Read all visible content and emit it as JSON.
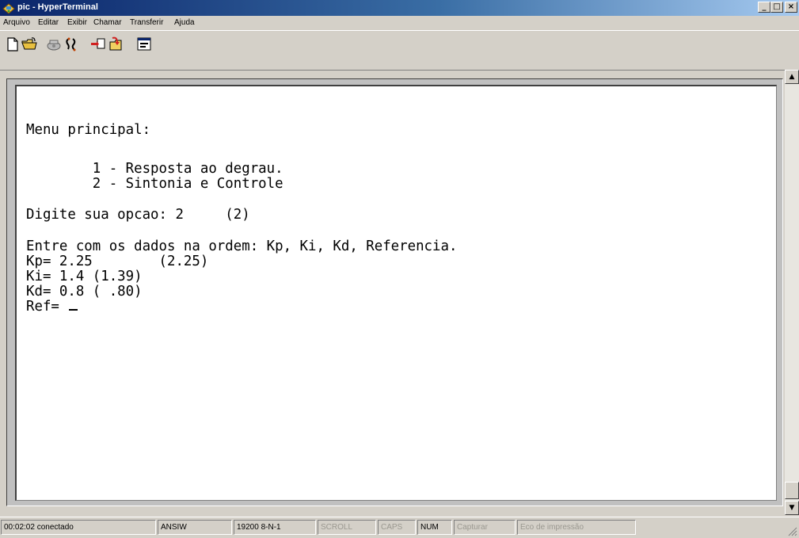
{
  "window": {
    "title": "pic - HyperTerminal",
    "controls": {
      "minimize": "_",
      "maximize": "□",
      "close": "×"
    }
  },
  "menu": {
    "items": [
      "Arquivo",
      "Editar",
      "Exibir",
      "Chamar",
      "Transferir",
      "Ajuda"
    ]
  },
  "toolbar": {
    "buttons": [
      "new-icon",
      "open-icon",
      "disconnect-phone-icon",
      "connect-phone-icon",
      "send-icon",
      "receive-icon",
      "properties-icon"
    ]
  },
  "terminal": {
    "lines": [
      "Menu principal:",
      "        1 - Resposta ao degrau.",
      "        2 - Sintonia e Controle",
      "Digite sua opcao: 2     (2)",
      "Entre com os dados na ordem: Kp, Ki, Kd, Referencia.",
      "Kp= 2.25        (2.25)",
      "Ki= 1.4 (1.39)",
      "Kd= 0.8 ( .80)",
      "Ref= "
    ]
  },
  "statusbar": {
    "connection": "00:02:02 conectado",
    "emulation": "ANSIW",
    "port_settings": "19200 8-N-1",
    "scroll": "SCROLL",
    "caps": "CAPS",
    "num": "NUM",
    "capture": "Capturar",
    "print_echo": "Eco de impressão"
  },
  "colors": {
    "titlebar_start": "#0a246a",
    "titlebar_end": "#a6caf0",
    "chrome": "#d4d0c8",
    "terminal_bg": "#ffffff",
    "text": "#000000"
  }
}
